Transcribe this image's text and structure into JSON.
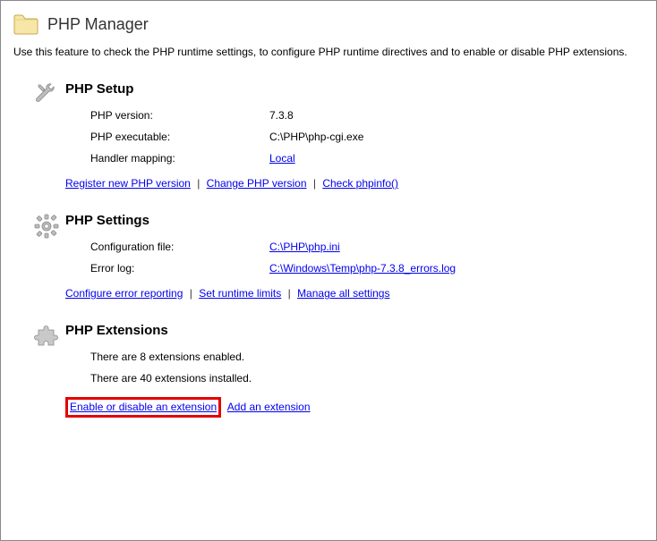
{
  "header": {
    "title": "PHP Manager",
    "description": "Use this feature to check the PHP runtime settings, to configure PHP runtime directives and to enable or disable PHP extensions."
  },
  "setup": {
    "title": "PHP Setup",
    "version_label": "PHP version:",
    "version_value": "7.3.8",
    "exe_label": "PHP executable:",
    "exe_value": "C:\\PHP\\php-cgi.exe",
    "handler_label": "Handler mapping:",
    "handler_value": "Local",
    "links": {
      "register": "Register new PHP version",
      "change": "Change PHP version",
      "phpinfo": "Check phpinfo()"
    }
  },
  "settings": {
    "title": "PHP Settings",
    "config_label": "Configuration file:",
    "config_value": "C:\\PHP\\php.ini",
    "error_log_label": "Error log:",
    "error_log_value": "C:\\Windows\\Temp\\php-7.3.8_errors.log",
    "links": {
      "configure": "Configure error reporting",
      "runtime": "Set runtime limits",
      "manage": "Manage all settings"
    }
  },
  "extensions": {
    "title": "PHP Extensions",
    "enabled_text": "There are 8 extensions enabled.",
    "installed_text": "There are 40 extensions installed.",
    "links": {
      "enable_disable": "Enable or disable an extension",
      "add": "Add an extension"
    }
  }
}
